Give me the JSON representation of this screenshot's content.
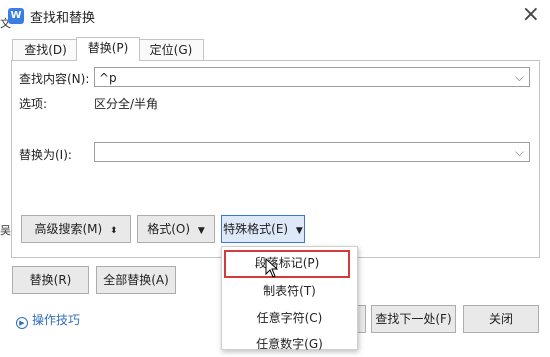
{
  "window": {
    "title": "查找和替换",
    "app_icon": "W"
  },
  "background_text": {
    "glyph_1": "文",
    "glyph_2": "吴"
  },
  "tabs": [
    {
      "label": "查找(D)",
      "active": false
    },
    {
      "label": "替换(P)",
      "active": true
    },
    {
      "label": "定位(G)",
      "active": false
    }
  ],
  "find": {
    "label": "查找内容(N):",
    "value": "^p",
    "dropdown": "chevron-down-icon"
  },
  "options": {
    "label": "选项:",
    "value": "区分全/半角"
  },
  "replace": {
    "label": "替换为(I):",
    "value": "",
    "dropdown": "chevron-down-icon"
  },
  "panel_buttons": {
    "advanced": "高级搜索(M)",
    "advanced_icon": "⬍",
    "format": "格式(O)",
    "special": "特殊格式(E)"
  },
  "bottom_buttons": {
    "replace": "替换(R)",
    "replace_all": "全部替换(A)",
    "find_prev_partial": ")",
    "find_next": "查找下一处(F)",
    "close": "关闭"
  },
  "tips": {
    "label": "操作技巧",
    "icon": "play-circle-icon"
  },
  "special_menu": {
    "items": [
      {
        "label": "段落标记(P)",
        "highlighted": true
      },
      {
        "label": "制表符(T)",
        "highlighted": false
      },
      {
        "label": "任意字符(C)",
        "highlighted": false
      },
      {
        "label": "任意数字(G)",
        "highlighted": false
      }
    ]
  },
  "colors": {
    "highlight_border": "#d23b3b",
    "link": "#2f6dbd",
    "primary_border": "#3b76d8"
  }
}
